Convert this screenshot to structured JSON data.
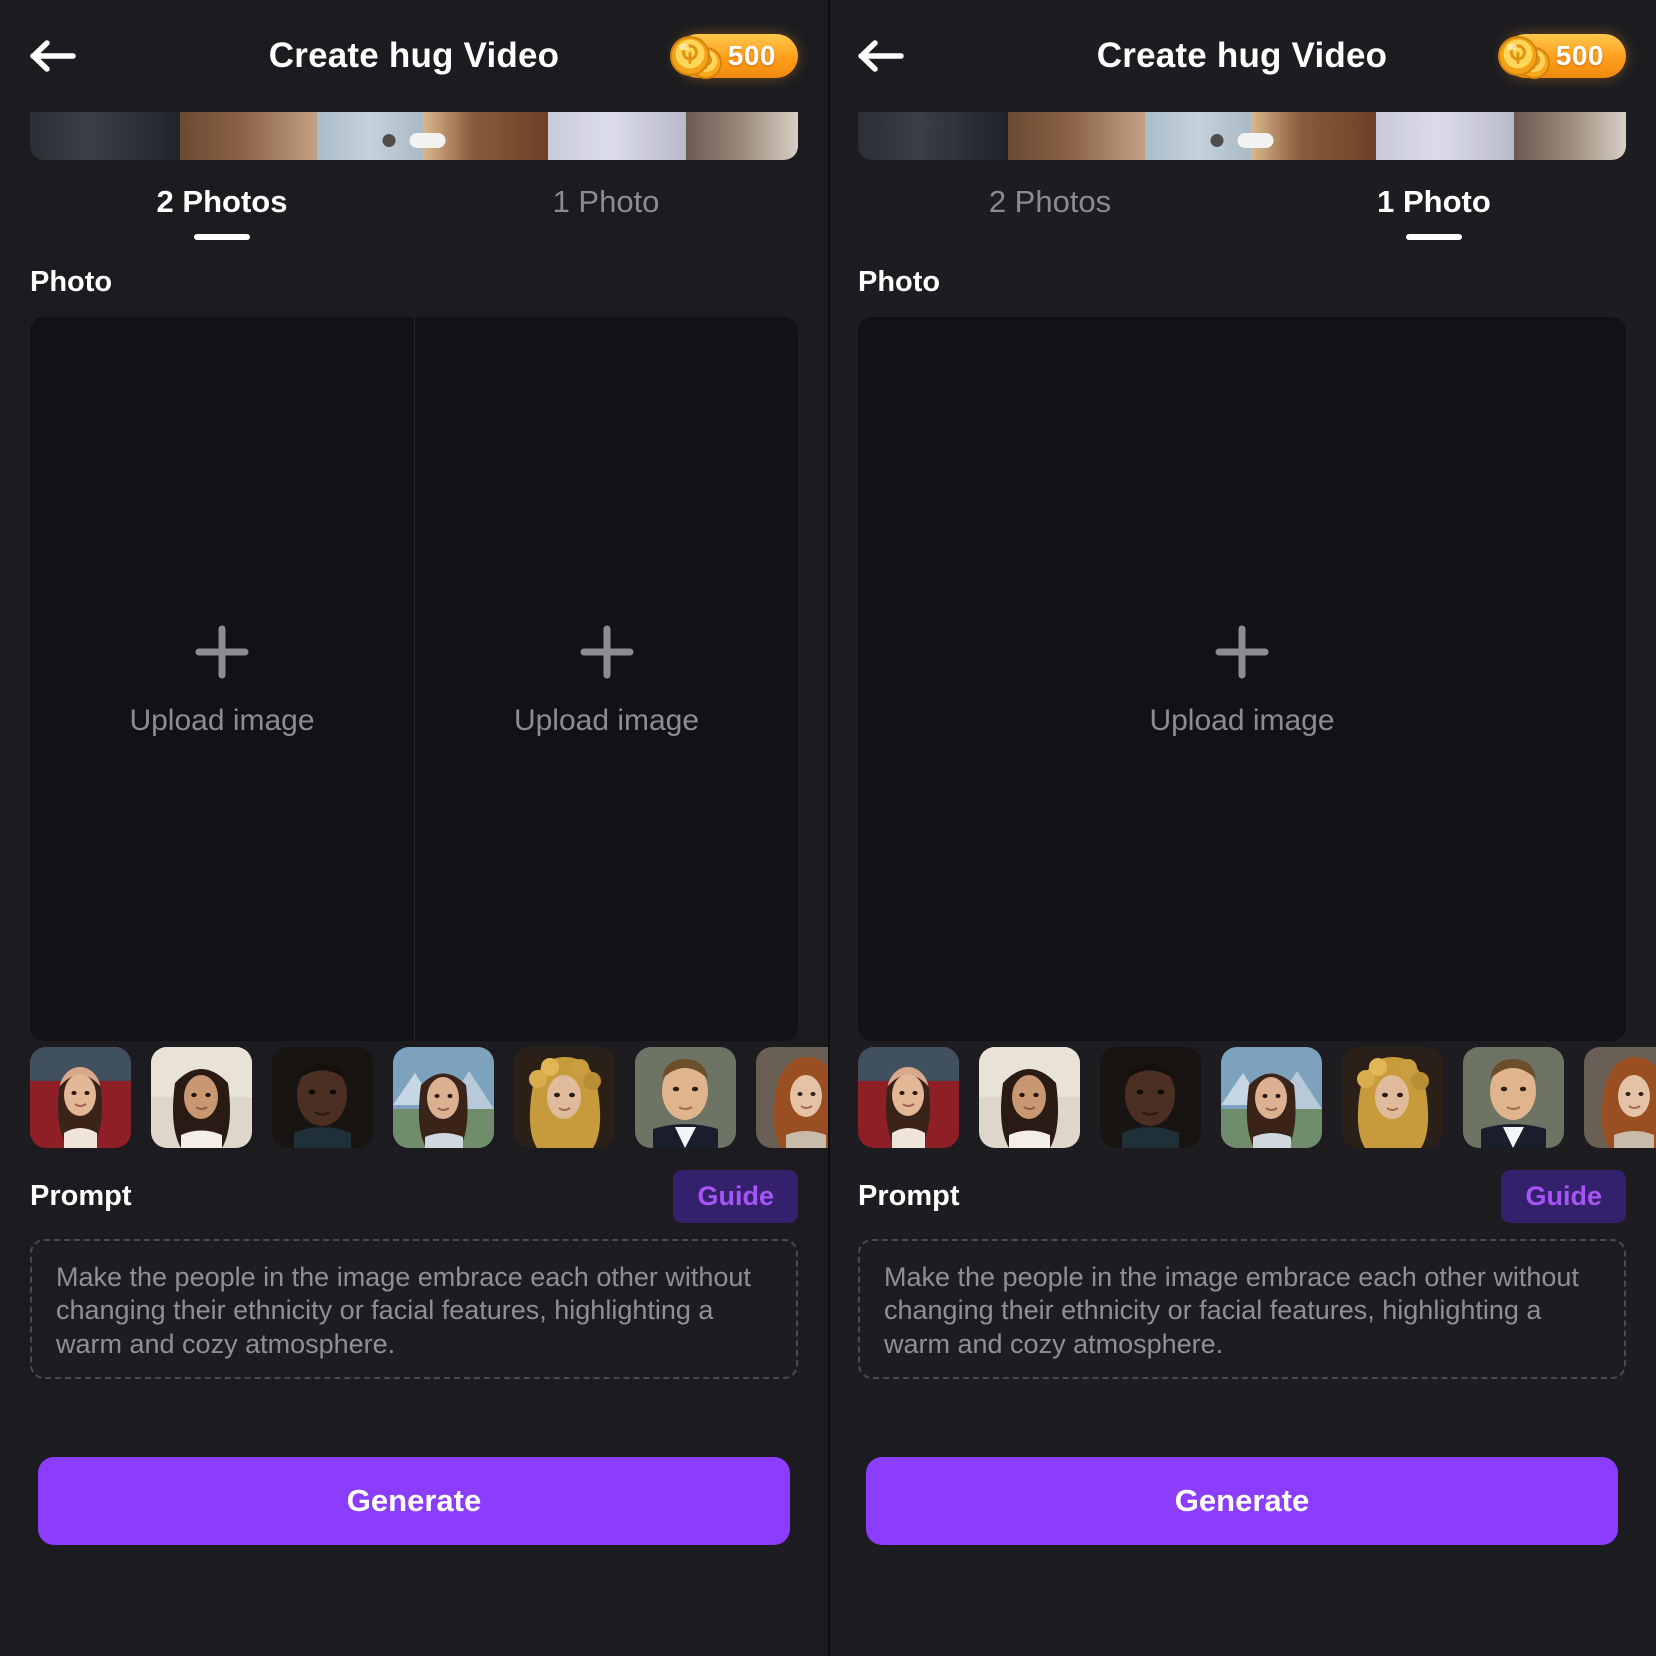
{
  "screens": [
    {
      "id": "left",
      "header": {
        "back_icon": "arrow-left-icon",
        "title": "Create hug Video",
        "coin_icon": "coin-stack-icon",
        "coin_count": "500"
      },
      "banner": {
        "dots": [
          "inactive",
          "active"
        ]
      },
      "tabs": [
        {
          "label": "2 Photos",
          "active": true
        },
        {
          "label": "1 Photo",
          "active": false
        }
      ],
      "photo_section": {
        "label": "Photo",
        "slots": [
          {
            "plus_icon": "plus-icon",
            "label": "Upload image"
          },
          {
            "plus_icon": "plus-icon",
            "label": "Upload image"
          }
        ]
      },
      "thumbnails": [
        {
          "name": "thumbnail-woman-red-carpet"
        },
        {
          "name": "thumbnail-woman-white-veil"
        },
        {
          "name": "thumbnail-man-dark-jacket"
        },
        {
          "name": "thumbnail-woman-mountain"
        },
        {
          "name": "thumbnail-woman-curly-gold"
        },
        {
          "name": "thumbnail-man-blue-suit"
        },
        {
          "name": "thumbnail-woman-redhead"
        }
      ],
      "prompt": {
        "title": "Prompt",
        "guide_label": "Guide",
        "text": "Make the people in the image embrace each other without changing their ethnicity or facial features, highlighting a warm and cozy atmosphere."
      },
      "generate_label": "Generate"
    },
    {
      "id": "right",
      "header": {
        "back_icon": "arrow-left-icon",
        "title": "Create hug Video",
        "coin_icon": "coin-stack-icon",
        "coin_count": "500"
      },
      "banner": {
        "dots": [
          "inactive",
          "active"
        ]
      },
      "tabs": [
        {
          "label": "2 Photos",
          "active": false
        },
        {
          "label": "1 Photo",
          "active": true
        }
      ],
      "photo_section": {
        "label": "Photo",
        "slots": [
          {
            "plus_icon": "plus-icon",
            "label": "Upload image"
          }
        ]
      },
      "thumbnails": [
        {
          "name": "thumbnail-woman-red-carpet"
        },
        {
          "name": "thumbnail-woman-white-veil"
        },
        {
          "name": "thumbnail-man-dark-jacket"
        },
        {
          "name": "thumbnail-woman-mountain"
        },
        {
          "name": "thumbnail-woman-curly-gold"
        },
        {
          "name": "thumbnail-man-blue-suit"
        },
        {
          "name": "thumbnail-woman-redhead"
        }
      ],
      "prompt": {
        "title": "Prompt",
        "guide_label": "Guide",
        "text": "Make the people in the image embrace each other without changing their ethnicity or facial features, highlighting a warm and cozy atmosphere."
      },
      "generate_label": "Generate"
    }
  ],
  "colors": {
    "background": "#1a1a1f",
    "upload_panel": "#121216",
    "accent_purple": "#8b3dfb",
    "guide_bg": "#33216b",
    "guide_text": "#a855f7",
    "coin_gold": "#ff9e1b",
    "text_primary": "#ffffff",
    "text_muted": "#8b8b92"
  }
}
